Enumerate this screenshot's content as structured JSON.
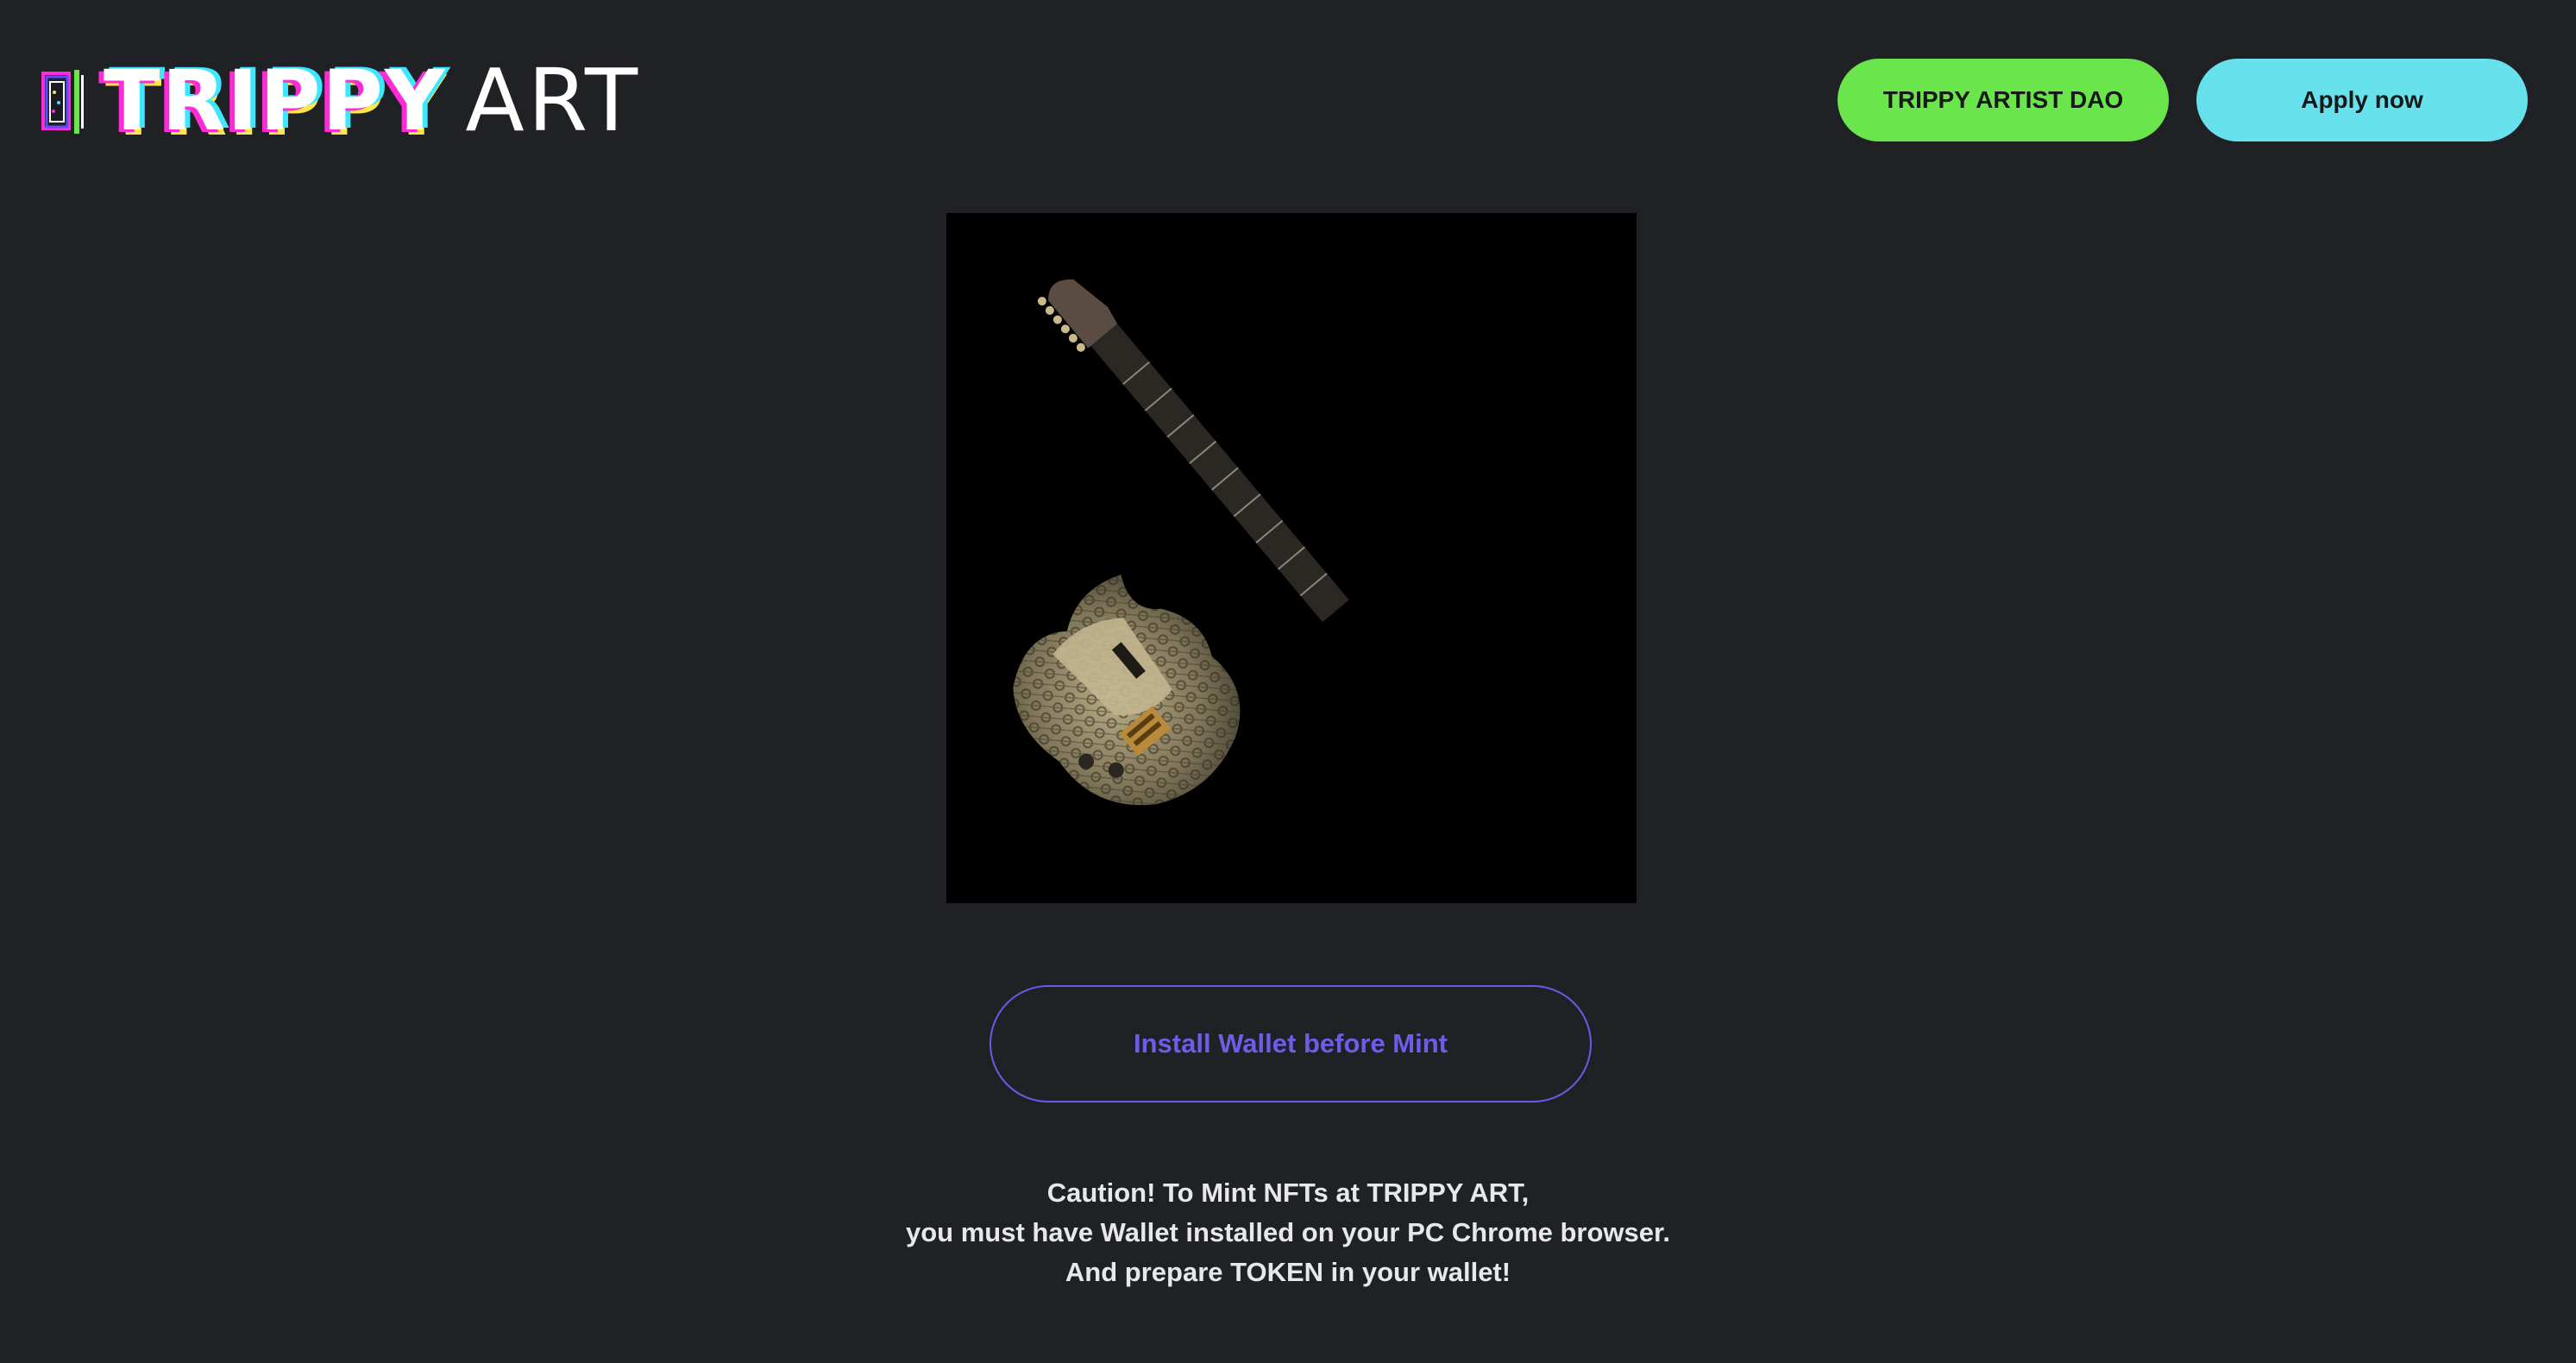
{
  "header": {
    "logo_word_1": "TRIPPY",
    "logo_word_2": "ART",
    "dao_button_label": "TRIPPY ARTIST DAO",
    "apply_button_label": "Apply now"
  },
  "colors": {
    "background": "#202125",
    "dao_button": "#6ae54c",
    "apply_button": "#67e1eb",
    "install_accent": "#6f5ce8"
  },
  "nft": {
    "icon": "guitar-nft-image"
  },
  "install": {
    "label": "Install Wallet before Mint"
  },
  "caution": {
    "line_1": "Caution! To Mint NFTs at TRIPPY ART,",
    "line_2": "you must have Wallet installed on your PC Chrome browser.",
    "line_3": "And prepare TOKEN in your wallet!"
  }
}
